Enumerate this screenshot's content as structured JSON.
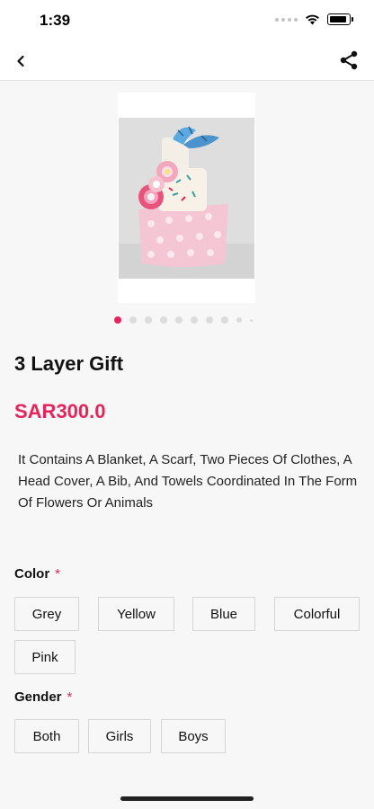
{
  "status_bar": {
    "time": "1:39"
  },
  "icons": {
    "back": "chevron-left-icon",
    "share": "share-icon",
    "wifi": "wifi-icon",
    "battery": "battery-icon"
  },
  "colors": {
    "accent": "#e5245a",
    "background": "#f7f7f7",
    "border": "#d6d6d6"
  },
  "gallery": {
    "image_count": 10,
    "active_index": 0
  },
  "product": {
    "title": "3 Layer Gift",
    "price": "SAR300.0",
    "description": "It Contains A Blanket, A Scarf, Two Pieces Of Clothes, A Head Cover, A Bib, And Towels Coordinated In The Form Of Flowers Or Animals"
  },
  "options": {
    "color": {
      "label": "Color",
      "required_mark": "*",
      "values": [
        "Grey",
        "Yellow",
        "Blue",
        "Colorful",
        "Pink"
      ]
    },
    "gender": {
      "label": "Gender",
      "required_mark": "*",
      "values": [
        "Both",
        "Girls",
        "Boys"
      ]
    }
  }
}
